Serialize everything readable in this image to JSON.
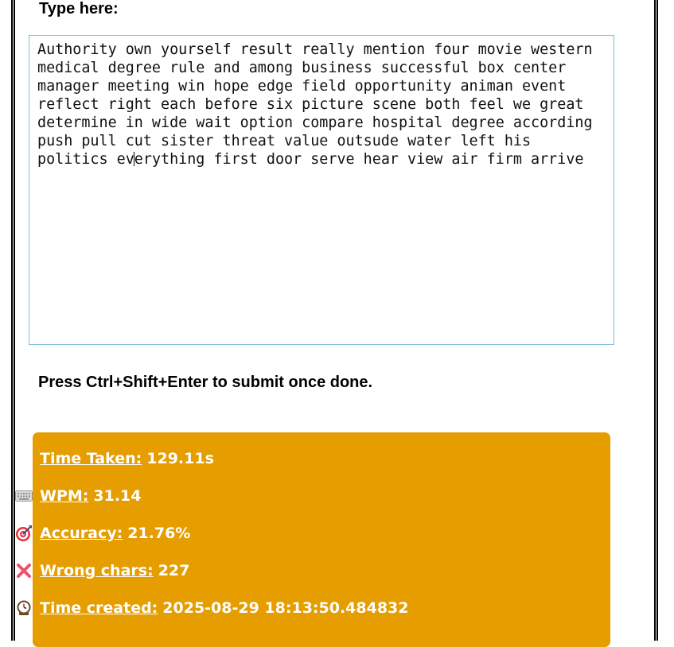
{
  "form": {
    "label": "Type here:",
    "typed_before_caret": "Authority own yourself result really mention four movie western\nmedical degree rule and among business successful box center\nmanager meeting win hope edge field opportunity animan event\nreflect right each before six picture scene both feel we great\ndetermine in wide wait option compare hospital degree according\npush pull cut sister threat value outsude water left his\npolitics ev",
    "typed_after_caret": "erything first door serve hear view air firm arrive",
    "hint": "Press Ctrl+Shift+Enter to submit once done."
  },
  "results": {
    "background_color": "#e59d00",
    "time_taken": {
      "icon": "stopwatch-icon",
      "label": "Time Taken:",
      "value": "129.11s"
    },
    "wpm": {
      "icon": "keyboard-icon",
      "label": "WPM:",
      "value": "31.14"
    },
    "accuracy": {
      "icon": "target-icon",
      "label": "Accuracy:",
      "value": "21.76%"
    },
    "wrong_chars": {
      "icon": "cross-mark-icon",
      "label": "Wrong chars:",
      "value": "227"
    },
    "time_created": {
      "icon": "clock-icon",
      "label": "Time created:",
      "value": "2025-08-29 18:13:50.484832"
    }
  }
}
